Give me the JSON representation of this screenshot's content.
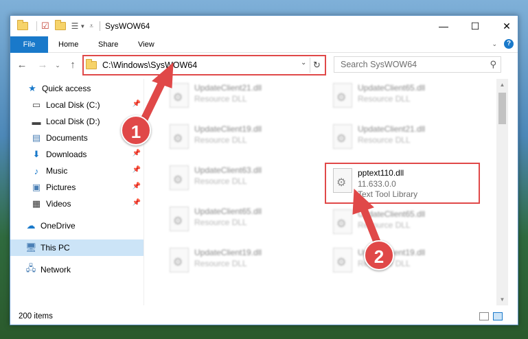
{
  "window": {
    "title": "SysWOW64",
    "controls": {
      "minimize": "—",
      "maximize": "☐",
      "close": "✕"
    }
  },
  "ribbon": {
    "tabs": [
      "File",
      "Home",
      "Share",
      "View"
    ],
    "expand_icon": "chevron-down-icon",
    "help_label": "?"
  },
  "address": {
    "path": "C:\\Windows\\SysWOW64",
    "search_placeholder": "Search SysWOW64"
  },
  "nav": {
    "items": [
      {
        "label": "Quick access",
        "icon": "star-icon",
        "pinned": false
      },
      {
        "label": "Local Disk (C:)",
        "icon": "drive-icon",
        "pinned": true
      },
      {
        "label": "Local Disk (D:)",
        "icon": "drive-icon",
        "pinned": false
      },
      {
        "label": "Documents",
        "icon": "documents-icon",
        "pinned": false
      },
      {
        "label": "Downloads",
        "icon": "download-icon",
        "pinned": true
      },
      {
        "label": "Music",
        "icon": "music-icon",
        "pinned": true
      },
      {
        "label": "Pictures",
        "icon": "pictures-icon",
        "pinned": true
      },
      {
        "label": "Videos",
        "icon": "videos-icon",
        "pinned": true
      },
      {
        "label": "OneDrive",
        "icon": "cloud-icon",
        "pinned": false
      },
      {
        "label": "This PC",
        "icon": "computer-icon",
        "pinned": false
      },
      {
        "label": "Network",
        "icon": "network-icon",
        "pinned": false
      }
    ]
  },
  "files": {
    "left": [
      {
        "name": "UpdateClient21.dll",
        "desc": "Resource DLL"
      },
      {
        "name": "UpdateClient19.dll",
        "desc": "Resource DLL"
      },
      {
        "name": "UpdateClient63.dll",
        "desc": "Resource DLL"
      },
      {
        "name": "UpdateClient65.dll",
        "desc": "Resource DLL"
      },
      {
        "name": "UpdateClient19.dll",
        "desc": "Resource DLL"
      }
    ],
    "right": [
      {
        "name": "UpdateClient65.dll",
        "desc": "Resource DLL"
      },
      {
        "name": "UpdateClient21.dll",
        "desc": "Resource DLL"
      },
      {
        "name": "UpdateClient65.dll",
        "desc": "Resource DLL"
      },
      {
        "name": "UpdateClient19.dll",
        "desc": "Resource DLL"
      }
    ],
    "highlighted": {
      "name": "pptext110.dll",
      "version": "11.633.0.0",
      "desc": "Text Tool Library"
    }
  },
  "status": {
    "item_count": "200 items"
  },
  "annotations": {
    "step1": "1",
    "step2": "2",
    "color": "#e04848"
  },
  "colors": {
    "accent": "#1979ca",
    "selection": "#cce4f7",
    "highlight": "#e04848"
  }
}
